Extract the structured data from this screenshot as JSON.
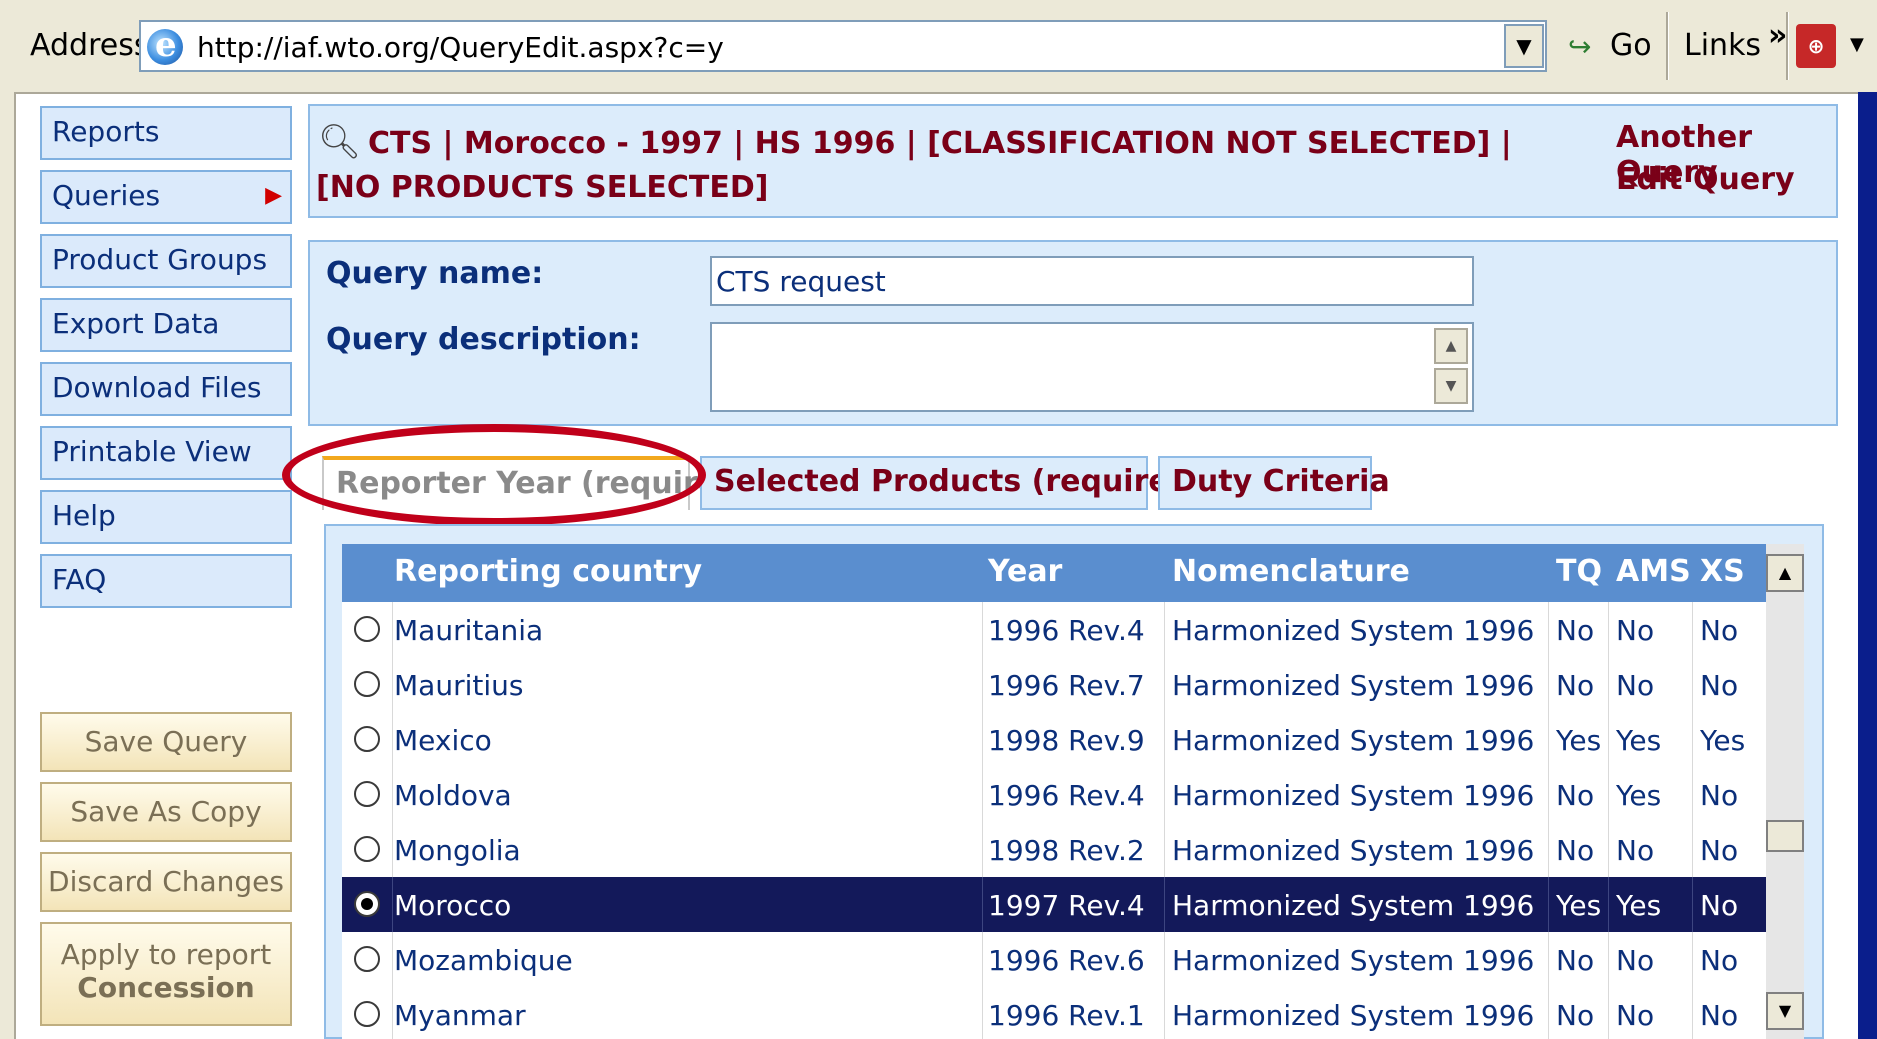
{
  "browser": {
    "address_label": "Address",
    "url": "http://iaf.wto.org/QueryEdit.aspx?c=y",
    "go_label": "Go",
    "links_label": "Links",
    "links_chevron": "»"
  },
  "sidebar": {
    "items": [
      {
        "label": "Reports"
      },
      {
        "label": "Queries"
      },
      {
        "label": "Product Groups"
      },
      {
        "label": "Export Data"
      },
      {
        "label": "Download Files"
      },
      {
        "label": "Printable View"
      },
      {
        "label": "Help"
      },
      {
        "label": "FAQ"
      }
    ],
    "actions": {
      "save_query": "Save Query",
      "save_as_copy": "Save As Copy",
      "discard_changes": "Discard Changes",
      "apply_line1": "Apply to report",
      "apply_line2": "Concession"
    }
  },
  "header": {
    "line1": "CTS | Morocco - 1997 | HS 1996 | [CLASSIFICATION NOT SELECTED] |",
    "line2": "[NO PRODUCTS SELECTED]",
    "another_query": "Another Query",
    "edit_query": "Edit Query"
  },
  "form": {
    "query_name_label": "Query name:",
    "query_name_value": "CTS request",
    "query_description_label": "Query description:",
    "query_description_value": ""
  },
  "tabs": [
    {
      "label": "Reporter Year (required)",
      "active": true
    },
    {
      "label": "Selected Products (required)",
      "active": false
    },
    {
      "label": "Duty Criteria",
      "active": false
    }
  ],
  "grid": {
    "columns": [
      "Reporting country",
      "Year",
      "Nomenclature",
      "TQ",
      "AMS",
      "XS"
    ],
    "rows": [
      {
        "country": "Mauritania",
        "year": "1996 Rev.4",
        "nomenclature": "Harmonized System 1996",
        "tq": "No",
        "ams": "No",
        "xs": "No",
        "selected": false
      },
      {
        "country": "Mauritius",
        "year": "1996 Rev.7",
        "nomenclature": "Harmonized System 1996",
        "tq": "No",
        "ams": "No",
        "xs": "No",
        "selected": false
      },
      {
        "country": "Mexico",
        "year": "1998 Rev.9",
        "nomenclature": "Harmonized System 1996",
        "tq": "Yes",
        "ams": "Yes",
        "xs": "Yes",
        "selected": false
      },
      {
        "country": "Moldova",
        "year": "1996 Rev.4",
        "nomenclature": "Harmonized System 1996",
        "tq": "No",
        "ams": "Yes",
        "xs": "No",
        "selected": false
      },
      {
        "country": "Mongolia",
        "year": "1998 Rev.2",
        "nomenclature": "Harmonized System 1996",
        "tq": "No",
        "ams": "No",
        "xs": "No",
        "selected": false
      },
      {
        "country": "Morocco",
        "year": "1997 Rev.4",
        "nomenclature": "Harmonized System 1996",
        "tq": "Yes",
        "ams": "Yes",
        "xs": "No",
        "selected": true
      },
      {
        "country": "Mozambique",
        "year": "1996 Rev.6",
        "nomenclature": "Harmonized System 1996",
        "tq": "No",
        "ams": "No",
        "xs": "No",
        "selected": false
      },
      {
        "country": "Myanmar",
        "year": "1996 Rev.1",
        "nomenclature": "Harmonized System 1996",
        "tq": "No",
        "ams": "No",
        "xs": "No",
        "selected": false
      }
    ]
  },
  "colors": {
    "accent_dark_red": "#7a0018",
    "nav_blue": "#0b2f7a",
    "grid_header": "#5a8ecf",
    "selected_row": "#13195a",
    "highlight_ellipse": "#c0001a",
    "panel_bg": "#dcecfb"
  }
}
